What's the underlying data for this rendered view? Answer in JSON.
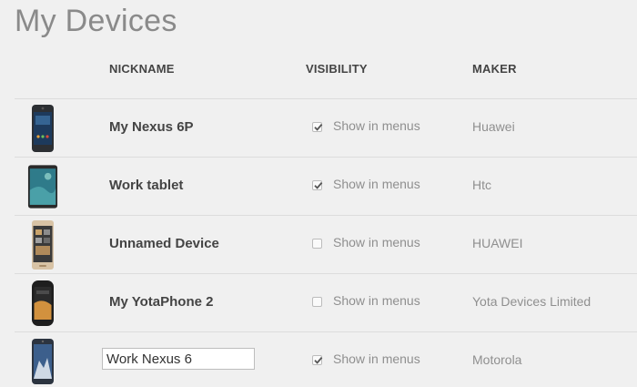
{
  "page": {
    "title": "My Devices"
  },
  "columns": {
    "nickname": "NICKNAME",
    "visibility": "VISIBILITY",
    "maker": "MAKER"
  },
  "devices": [
    {
      "icon": "nexus-6p-phone-icon",
      "nickname": "My Nexus 6P",
      "editing": false,
      "show_in_menus": true,
      "visibility_label": "Show in menus",
      "maker": "Huawei"
    },
    {
      "icon": "tablet-icon",
      "nickname": "Work tablet",
      "editing": false,
      "show_in_menus": true,
      "visibility_label": "Show in menus",
      "maker": "Htc"
    },
    {
      "icon": "gold-phone-icon",
      "nickname": "Unnamed Device",
      "editing": false,
      "show_in_menus": false,
      "visibility_label": "Show in menus",
      "maker": "HUAWEI"
    },
    {
      "icon": "yotaphone-icon",
      "nickname": "My YotaPhone 2",
      "editing": false,
      "show_in_menus": false,
      "visibility_label": "Show in menus",
      "maker": "Yota Devices Limited"
    },
    {
      "icon": "nexus-6-phone-icon",
      "nickname": "Work Nexus 6",
      "editing": true,
      "show_in_menus": true,
      "visibility_label": "Show in menus",
      "maker": "Motorola"
    }
  ],
  "colors": {
    "background": "#f0f0f0",
    "row_divider": "#dcdcdc",
    "header_text": "#444444",
    "muted_text": "#8f8f8f"
  }
}
